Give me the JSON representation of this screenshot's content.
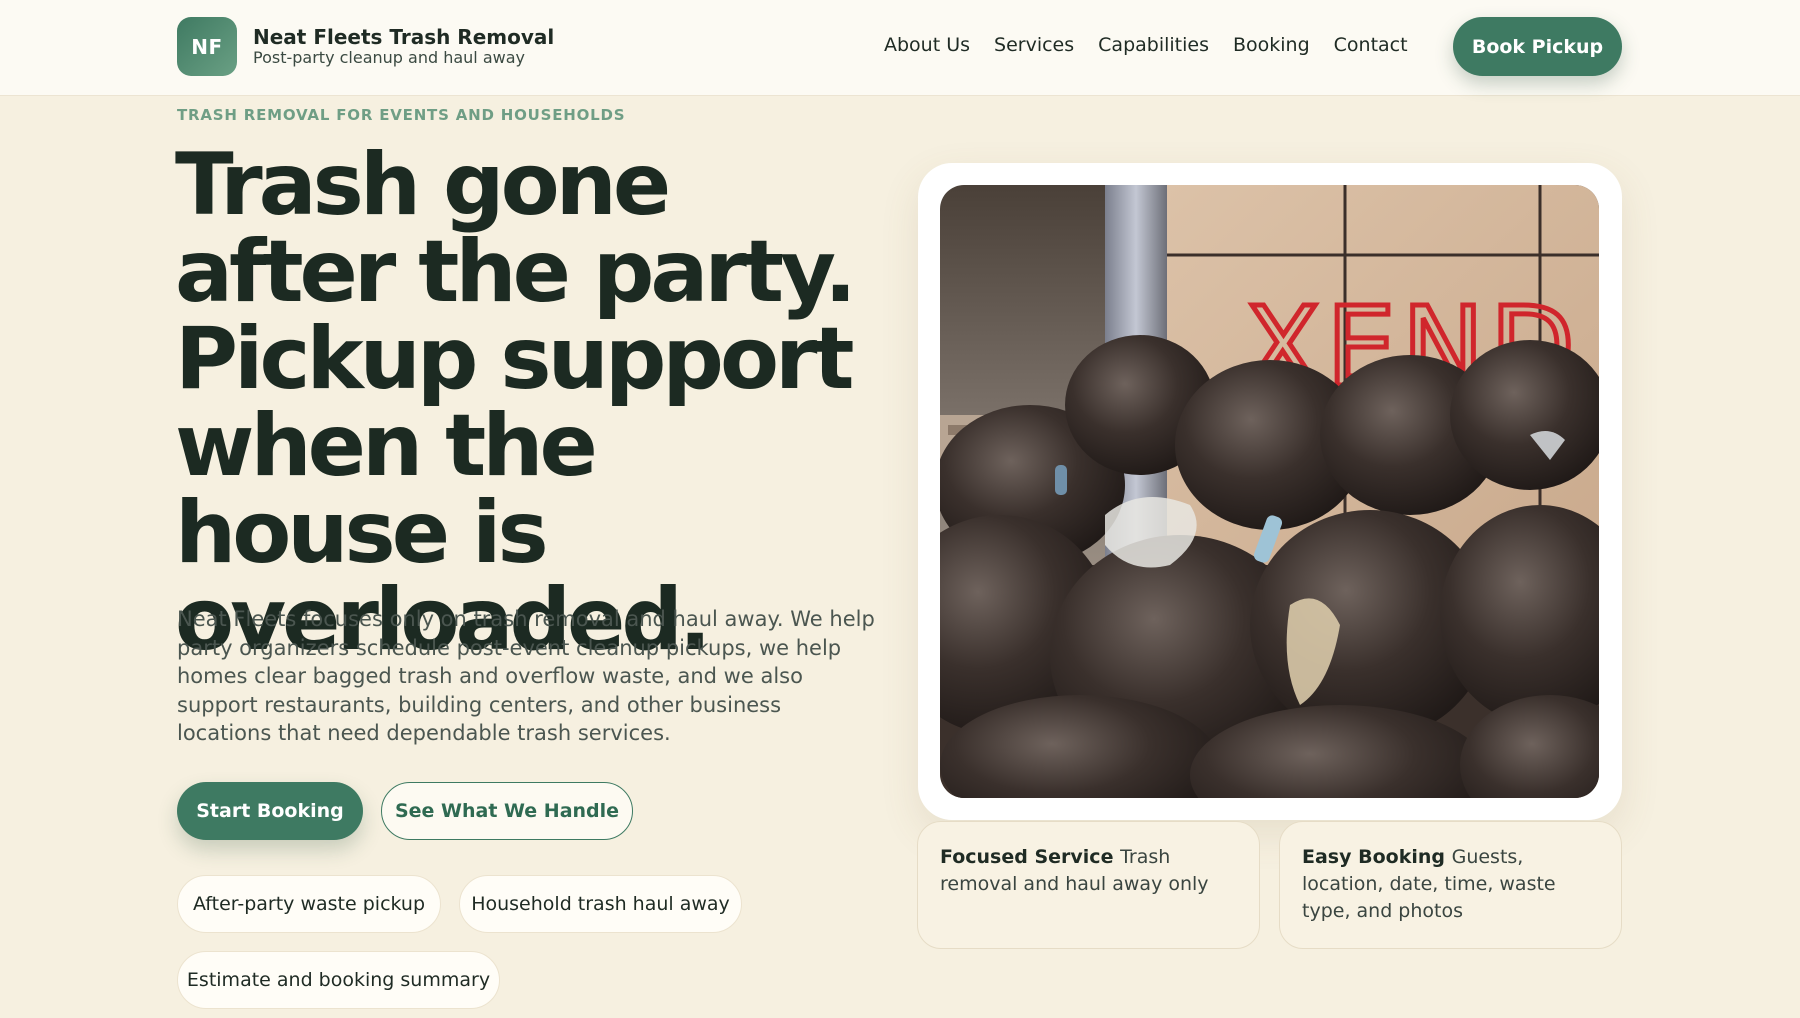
{
  "header": {
    "logo_initials": "NF",
    "brand_name": "Neat Fleets Trash Removal",
    "brand_tagline": "Post-party cleanup and haul away",
    "nav": [
      "About Us",
      "Services",
      "Capabilities",
      "Booking",
      "Contact"
    ],
    "cta": "Book Pickup"
  },
  "hero": {
    "eyebrow": "TRASH REMOVAL FOR EVENTS AND HOUSEHOLDS",
    "headline": "Trash gone after the party. Pickup support when the house is overloaded.",
    "lead": "Neat Fleets focuses only on trash removal and haul away. We help party organizers schedule post-event cleanup pickups, we help homes clear bagged trash and overflow waste, and we also support restaurants, building centers, and other business locations that need dependable trash services.",
    "primary_button": "Start Booking",
    "secondary_button": "See What We Handle",
    "chips": [
      "After-party waste pickup",
      "Household trash haul away",
      "Estimate and booking summary"
    ]
  },
  "image": {
    "graffiti": "XEND"
  },
  "cards": [
    {
      "title": "Focused Service",
      "text": "Trash removal and haul away only"
    },
    {
      "title": "Easy Booking",
      "text": "Guests, location, date, time, waste type, and photos"
    }
  ],
  "colors": {
    "accent": "#3e7a62",
    "background": "#f6f0e0",
    "eyebrow": "#6f9e85"
  }
}
